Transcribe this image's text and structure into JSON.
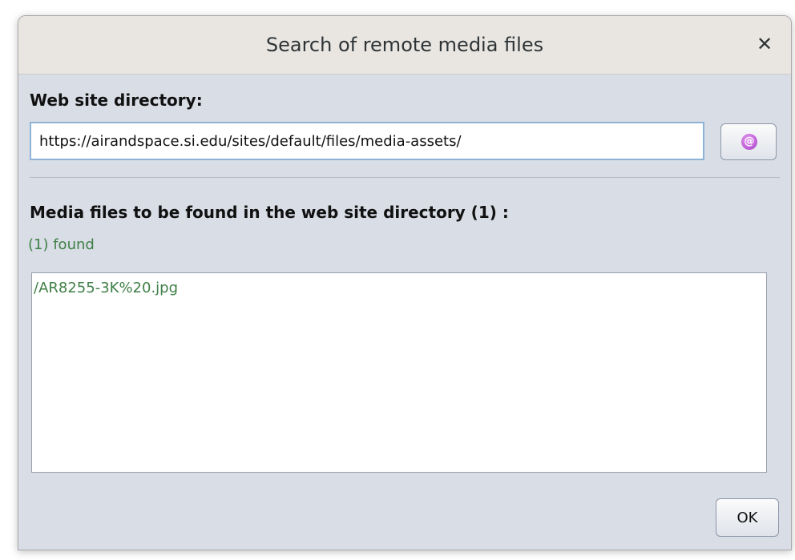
{
  "dialog": {
    "title": "Search of remote media files",
    "close_glyph": "✕"
  },
  "directory": {
    "label": "Web site directory:",
    "url_value": "https://airandspace.si.edu/sites/default/files/media-assets/",
    "browse_icon": "at-sign-icon",
    "browse_glyph": "@"
  },
  "media": {
    "label": "Media files to be found in the web site directory (1) :",
    "found_text": "(1) found",
    "files": [
      "/AR8255-3K%20.jpg"
    ]
  },
  "actions": {
    "ok_label": "OK"
  },
  "colors": {
    "found_text": "#3f7f46",
    "dialog_background": "#d9dde6",
    "titlebar_background": "#e9e6e2",
    "browse_icon": "#a63cc6"
  }
}
